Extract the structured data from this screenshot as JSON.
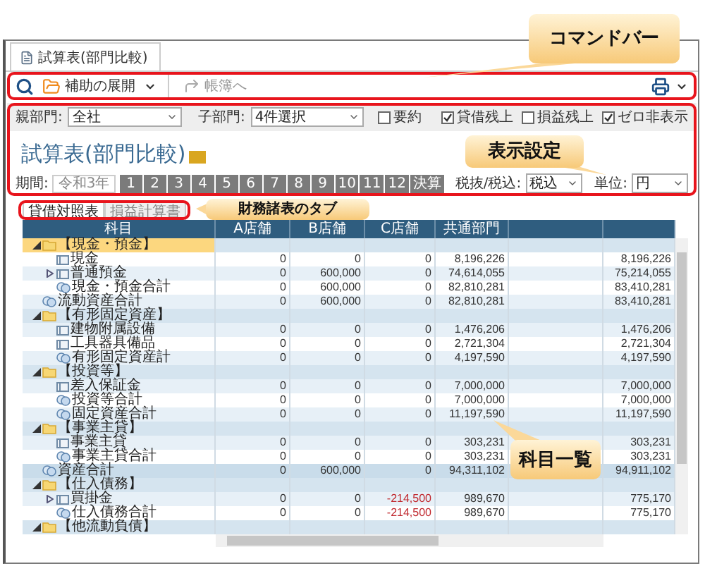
{
  "document_tab": {
    "title": "試算表(部門比較)",
    "selected": true
  },
  "command_bar": {
    "expand_label": "補助の展開",
    "ledger_label": "帳簿へ",
    "ledger_disabled": true
  },
  "filters": {
    "parent_label": "親部門:",
    "parent_value": "全社",
    "child_label": "子部門:",
    "child_value": "4件選択",
    "options": [
      {
        "label": "要約",
        "checked": false
      },
      {
        "label": "貸借残上",
        "checked": true
      },
      {
        "label": "損益残上",
        "checked": false
      },
      {
        "label": "ゼロ非表示",
        "checked": true
      }
    ]
  },
  "title": "試算表(部門比較)",
  "period": {
    "label": "期間:",
    "year": "令和3年",
    "months": [
      {
        "label": "1",
        "selected": true
      },
      {
        "label": "2",
        "selected": true
      },
      {
        "label": "3",
        "selected": true
      },
      {
        "label": "4",
        "selected": true
      },
      {
        "label": "5",
        "selected": true
      },
      {
        "label": "6",
        "selected": true
      },
      {
        "label": "7",
        "selected": true
      },
      {
        "label": "8",
        "selected": true
      },
      {
        "label": "9",
        "selected": true
      },
      {
        "label": "10",
        "selected": true
      },
      {
        "label": "11",
        "selected": true
      },
      {
        "label": "12",
        "selected": true
      },
      {
        "label": "決算",
        "selected": true
      }
    ]
  },
  "tax": {
    "label": "税抜/税込:",
    "value": "税込"
  },
  "unit": {
    "label": "単位:",
    "value": "円"
  },
  "statement_tabs": [
    {
      "label": "貸借対照表",
      "selected": true
    },
    {
      "label": "損益計算書",
      "selected": false
    }
  ],
  "table": {
    "columns": [
      "科目",
      "A店舗",
      "B店舗",
      "C店舗",
      "共通部門"
    ],
    "rows": [
      {
        "kind": "group",
        "label": "【現金・預金】",
        "expanded": true,
        "selected": true,
        "children": [
          {
            "kind": "account",
            "label": "現金",
            "selected": false,
            "values": {
              "a": "0",
              "b": "0",
              "c": "0",
              "common": "8,196,226",
              "total": "8,196,226"
            }
          },
          {
            "kind": "account",
            "label": "普通預金",
            "expanded": false,
            "selected": false,
            "values": {
              "a": "0",
              "b": "600,000",
              "c": "0",
              "common": "74,614,055",
              "total": "75,214,055"
            }
          },
          {
            "kind": "subtotal",
            "label": "現金・預金合計",
            "selected": false,
            "values": {
              "a": "0",
              "b": "600,000",
              "c": "0",
              "common": "82,810,281",
              "total": "83,410,281"
            }
          }
        ]
      },
      {
        "kind": "subtotal",
        "label": "流動資産合計",
        "selected": false,
        "values": {
          "a": "0",
          "b": "600,000",
          "c": "0",
          "common": "82,810,281",
          "total": "83,410,281"
        }
      },
      {
        "kind": "group",
        "label": "【有形固定資産】",
        "expanded": true,
        "selected": false,
        "children": [
          {
            "kind": "account",
            "label": "建物附属設備",
            "selected": false,
            "values": {
              "a": "0",
              "b": "0",
              "c": "0",
              "common": "1,476,206",
              "total": "1,476,206"
            }
          },
          {
            "kind": "account",
            "label": "工具器具備品",
            "selected": false,
            "values": {
              "a": "0",
              "b": "0",
              "c": "0",
              "common": "2,721,304",
              "total": "2,721,304"
            }
          },
          {
            "kind": "subtotal",
            "label": "有形固定資産計",
            "selected": false,
            "values": {
              "a": "0",
              "b": "0",
              "c": "0",
              "common": "4,197,590",
              "total": "4,197,590"
            }
          }
        ]
      },
      {
        "kind": "group",
        "label": "【投資等】",
        "expanded": true,
        "selected": false,
        "children": [
          {
            "kind": "account",
            "label": "差入保証金",
            "selected": false,
            "values": {
              "a": "0",
              "b": "0",
              "c": "0",
              "common": "7,000,000",
              "total": "7,000,000"
            }
          },
          {
            "kind": "subtotal",
            "label": "投資等合計",
            "selected": false,
            "values": {
              "a": "0",
              "b": "0",
              "c": "0",
              "common": "7,000,000",
              "total": "7,000,000"
            }
          },
          {
            "kind": "subtotal",
            "label": "固定資産合計",
            "selected": false,
            "values": {
              "a": "0",
              "b": "0",
              "c": "0",
              "common": "11,197,590",
              "total": "11,197,590"
            }
          }
        ]
      },
      {
        "kind": "group",
        "label": "【事業主貸】",
        "expanded": true,
        "selected": false,
        "children": [
          {
            "kind": "account",
            "label": "事業主貸",
            "selected": false,
            "values": {
              "a": "0",
              "b": "0",
              "c": "0",
              "common": "303,231",
              "total": "303,231"
            }
          },
          {
            "kind": "subtotal",
            "label": "事業主貸合計",
            "selected": false,
            "values": {
              "a": "0",
              "b": "0",
              "c": "0",
              "common": "303,231",
              "total": "303,231"
            }
          }
        ]
      },
      {
        "kind": "total",
        "label": "資産合計",
        "selected": false,
        "values": {
          "a": "0",
          "b": "600,000",
          "c": "0",
          "common": "94,311,102",
          "total": "94,911,102"
        }
      },
      {
        "kind": "group",
        "label": "【仕入債務】",
        "expanded": true,
        "selected": false,
        "children": [
          {
            "kind": "account",
            "label": "買掛金",
            "expanded": false,
            "selected": false,
            "values": {
              "a": "0",
              "b": "0",
              "c": "-214,500",
              "common": "989,670",
              "total": "775,170"
            }
          },
          {
            "kind": "subtotal",
            "label": "仕入債務合計",
            "selected": false,
            "values": {
              "a": "0",
              "b": "0",
              "c": "-214,500",
              "common": "989,670",
              "total": "775,170"
            }
          }
        ]
      },
      {
        "kind": "group",
        "label": "【他流動負債】",
        "expanded": true,
        "selected": false
      }
    ]
  },
  "callouts": [
    {
      "text": "コマンドバー"
    },
    {
      "text": "表示設定"
    },
    {
      "text": "財務諸表のタブ"
    },
    {
      "text": "科目一覧"
    }
  ]
}
